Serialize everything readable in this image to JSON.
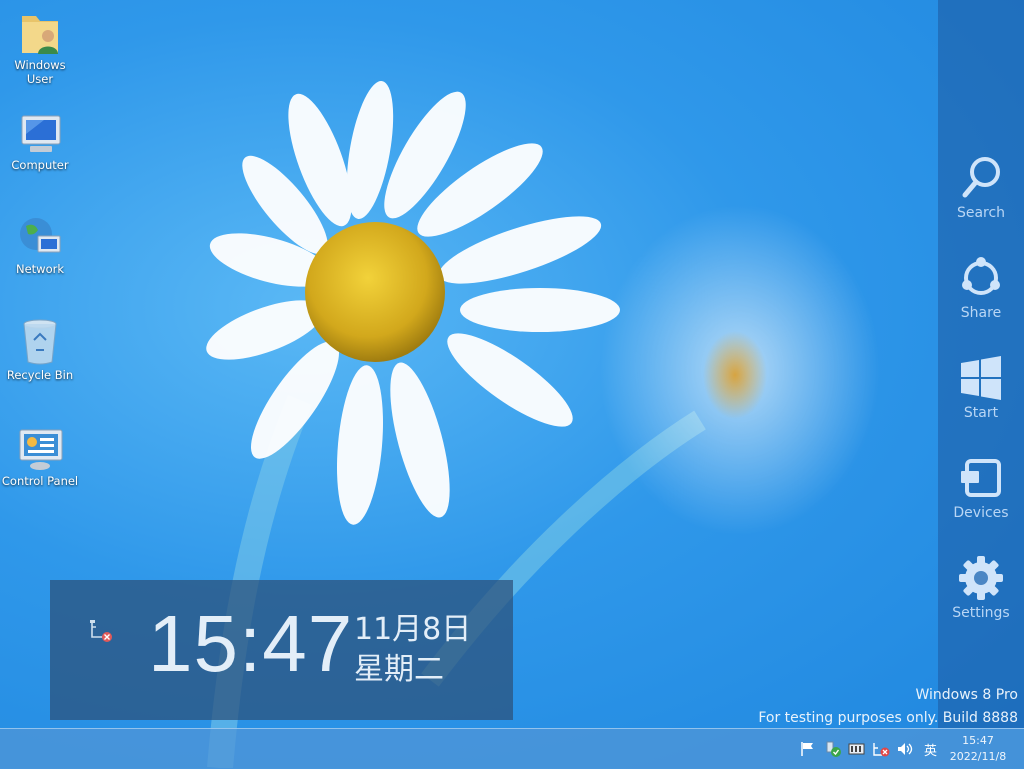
{
  "desktop": {
    "icons": [
      {
        "label": "Windows User",
        "icon": "user-folder-icon"
      },
      {
        "label": "Computer",
        "icon": "computer-icon"
      },
      {
        "label": "Network",
        "icon": "network-icon"
      },
      {
        "label": "Recycle Bin",
        "icon": "recycle-bin-icon"
      },
      {
        "label": "Control Panel",
        "icon": "control-panel-icon"
      }
    ]
  },
  "charms": {
    "items": [
      {
        "label": "Search",
        "icon": "search-icon"
      },
      {
        "label": "Share",
        "icon": "share-icon"
      },
      {
        "label": "Start",
        "icon": "windows-logo-icon"
      },
      {
        "label": "Devices",
        "icon": "devices-icon"
      },
      {
        "label": "Settings",
        "icon": "gear-icon"
      }
    ]
  },
  "clock_overlay": {
    "time": "15:47",
    "date": "11月8日",
    "weekday": "星期二"
  },
  "watermark": {
    "edition": "Windows 8 Pro",
    "build": "For testing purposes only. Build 8888"
  },
  "taskbar": {
    "tray_icons": [
      "action-center-flag-icon",
      "safely-remove-hardware-icon",
      "power-icon",
      "network-disconnected-icon",
      "volume-icon"
    ],
    "ime": "英",
    "time": "15:47",
    "date": "2022/11/8"
  },
  "colors": {
    "charms_bg": "#1e5aa0",
    "accent": "#2f98ea"
  }
}
